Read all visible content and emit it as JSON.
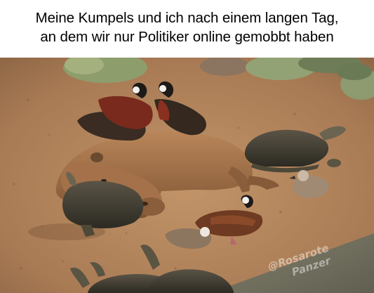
{
  "caption": {
    "line1": "Meine Kumpels und ich nach einem langen Tag,",
    "line2": "an dem wir nur Politiker online gemobbt haben"
  },
  "watermark": {
    "line1": "@Rosarote",
    "line2": "Panzer"
  },
  "colors": {
    "sand": "#b98a62",
    "capybara": "#9a6b44",
    "turtle_shell": "#3e3a30",
    "duck_chestnut": "#7a2a1c",
    "rock": "#8a9a6e"
  }
}
